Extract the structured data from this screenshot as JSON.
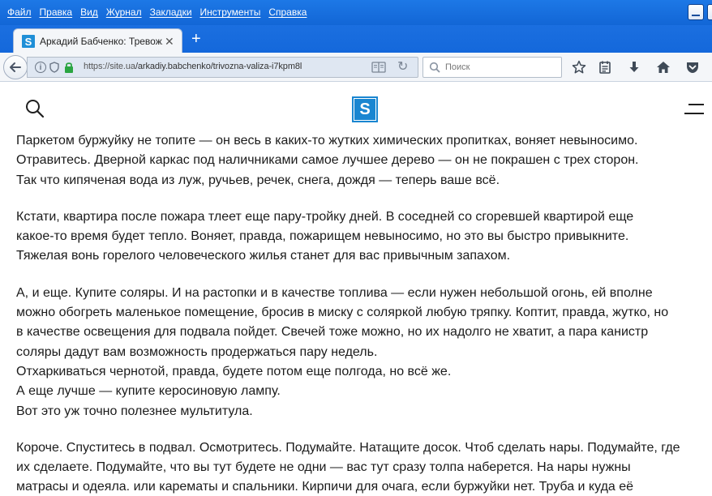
{
  "browser": {
    "menu": [
      "Файл",
      "Правка",
      "Вид",
      "Журнал",
      "Закладки",
      "Инструменты",
      "Справка"
    ],
    "tab_title": "Аркадий Бабченко: Тревож...",
    "tab_favicon": "S",
    "url_host": "https://site.ua",
    "url_path": "/arkadiy.babchenko/trivozna-valiza-i7kpm8l",
    "search_placeholder": "Поиск",
    "accent": "#1468db"
  },
  "site": {
    "logo_letter": "S",
    "logo_color": "#1a86d1"
  },
  "article": {
    "paragraphs": [
      [
        "Паркетом буржуйку не топите — он весь в каких-то жутких химических пропитках, воняет невыносимо.",
        "Отравитесь. Дверной каркас под наличниками самое лучшее дерево — он не покрашен с трех сторон.",
        "Так что кипяченая вода из луж, ручьев, речек, снега, дождя — теперь ваше всё."
      ],
      [
        "Кстати, квартира после пожара тлеет еще пару-тройку дней. В соседней со сгоревшей квартирой еще",
        "какое-то время будет тепло. Воняет, правда, пожарищем невыносимо, но это вы быстро привыкните.",
        "Тяжелая вонь горелого человеческого жилья станет для вас привычным запахом."
      ],
      [
        "А, и еще. Купите соляры. И на растопки и в качестве топлива — если нужен небольшой огонь, ей вполне",
        "можно обогреть маленькое помещение, бросив в миску с соляркой любую тряпку. Коптит, правда, жутко, но",
        "в качестве освещения для подвала пойдет. Свечей тоже можно, но их надолго не хватит, а пара канистр",
        "соляры дадут вам возможность продержаться пару недель.",
        "Отхаркиваться чернотой, правда, будете потом еще полгода, но всё же.",
        "А еще лучше — купите керосиновую лампу.",
        "Вот это уж точно полезнее мультитула."
      ],
      [
        "Короче. Спуститесь в подвал. Осмотритесь. Подумайте. Натащите досок. Чтоб сделать нары. Подумайте, где",
        "их сделаете. Подумайте, что вы тут будете не одни — вас тут сразу толпа наберется. На нары нужны",
        "матрасы и одеяла. или карематы и спальники. Кирпичи для очага, если буржуйки нет. Труба и куда её"
      ]
    ]
  }
}
